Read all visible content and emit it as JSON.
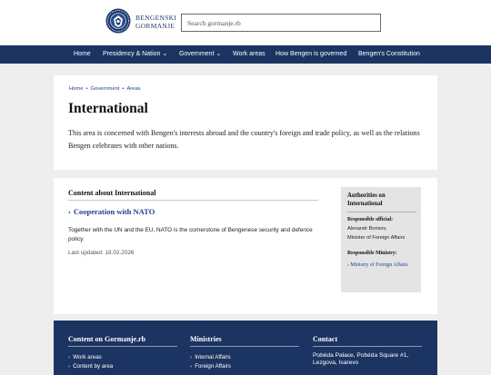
{
  "header": {
    "brand_line1": "BENGENSKI",
    "brand_line2": "GORMANJE",
    "search_placeholder": "Search gormanje.rb"
  },
  "nav": {
    "items": [
      {
        "label": "Home"
      },
      {
        "label": "Presidency & Nation ⌄"
      },
      {
        "label": "Government ⌄"
      },
      {
        "label": "Work areas"
      },
      {
        "label": "How Bengen is governed"
      },
      {
        "label": "Bengen's Constitution"
      }
    ]
  },
  "breadcrumb": {
    "items": [
      "Home",
      "Government",
      "Areas"
    ],
    "separator": "•"
  },
  "page": {
    "title": "International",
    "intro": "This area is concerned with Bengen's interests abroad and the country's foreign and trade policy, as well as the relations Bengen celebrates with other nations."
  },
  "content": {
    "heading": "Content about International",
    "items": [
      {
        "title": "Cooperation with NATO",
        "description": "Together with the UN and the EU, NATO is the cornerstone of Bengenese security and defence policy.",
        "updated": "Last updated: 18.02.2026"
      }
    ]
  },
  "authorities": {
    "title": "Authorities on International",
    "official_label": "Responsible official:",
    "official_name": "Alexandr Borisov,",
    "official_role": "Minister of Foreign Affairs",
    "ministry_label": "Responsible Ministry:",
    "ministry_link": "› Ministry of Foreign Affairs"
  },
  "footer": {
    "col1_title": "Content on Gormanje.rb",
    "col1_links": [
      "Work areas",
      "Content by area"
    ],
    "col2_title": "Ministries",
    "col2_links": [
      "Internal Affairs",
      "Foreign Affairs"
    ],
    "col3_title": "Contact",
    "address": "Pobéda Palace, Pobéda Square #1, Lezgova, Isarevo"
  },
  "icons": {
    "chevron": "chevron-right-icon",
    "emblem": "coat-of-arms-icon"
  },
  "colors": {
    "navy": "#1c3461",
    "link": "#1f3f8f",
    "background": "#eeeeee"
  }
}
